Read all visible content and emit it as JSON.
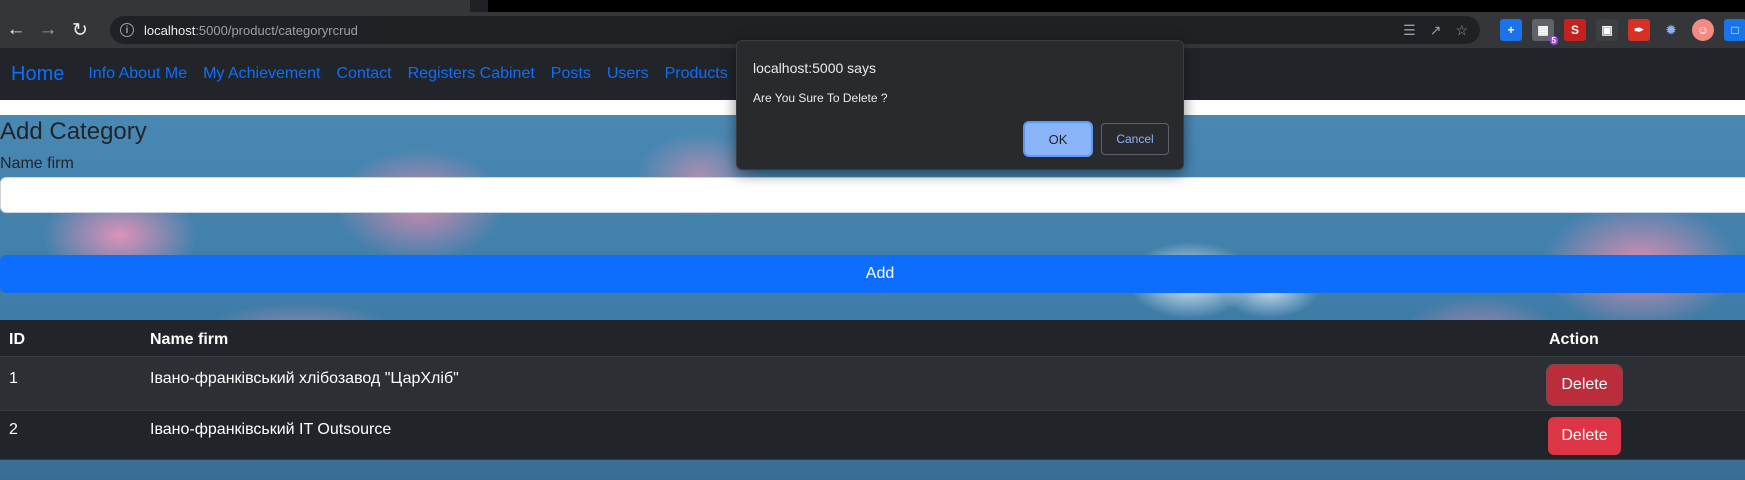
{
  "browser": {
    "url_host": "localhost",
    "url_path": ":5000/product/categoryrcrud",
    "extension_badge": "5"
  },
  "navbar": {
    "brand": "Home",
    "links": [
      "Info About Me",
      "My Achievement",
      "Contact",
      "Registers Cabinet",
      "Posts",
      "Users",
      "Products"
    ]
  },
  "form": {
    "heading": "Add Category",
    "name_label": "Name firm",
    "name_value": "",
    "add_label": "Add"
  },
  "table": {
    "headers": [
      "ID",
      "Name firm",
      "Action"
    ],
    "rows": [
      {
        "id": "1",
        "name": "Івано-франківський хлібозавод \"ЦарХліб\"",
        "action": "Delete"
      },
      {
        "id": "2",
        "name": "Івано-франківський IT Outsource",
        "action": "Delete"
      }
    ]
  },
  "dialog": {
    "title": "localhost:5000 says",
    "message": "Are You Sure To Delete ?",
    "ok_label": "OK",
    "cancel_label": "Cancel"
  },
  "colors": {
    "primary": "#0d6efd",
    "danger": "#dc3545",
    "navbar_bg": "#212529",
    "dialog_bg": "#292a2d"
  }
}
